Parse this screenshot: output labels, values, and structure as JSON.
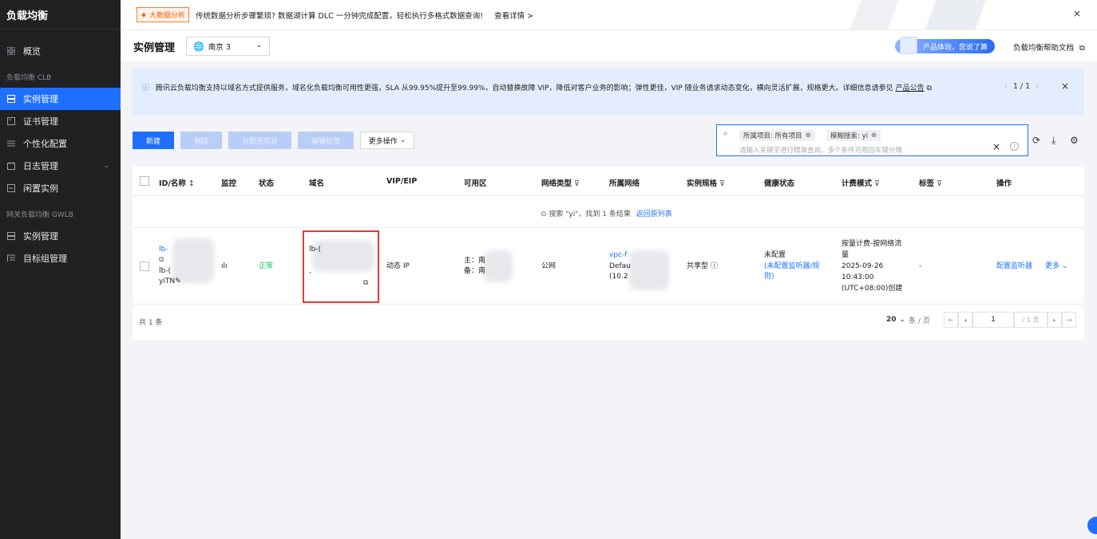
{
  "sidebar": {
    "brand": "负载均衡",
    "items": [
      {
        "label": "概览",
        "icon": "grid-icon"
      },
      {
        "label": "实例管理",
        "icon": "server-icon",
        "active": true
      },
      {
        "label": "证书管理",
        "icon": "certificate-icon"
      },
      {
        "label": "个性化配置",
        "icon": "sliders-icon"
      },
      {
        "label": "日志管理",
        "icon": "calendar-icon"
      },
      {
        "label": "闲置实例",
        "icon": "box-icon"
      },
      {
        "label": "实例管理",
        "icon": "server-icon"
      },
      {
        "label": "目标组管理",
        "icon": "list-icon"
      }
    ],
    "section_clb": "负载均衡 CLB",
    "section_gwlb": "网关负载均衡 GWLB"
  },
  "banner": {
    "badge": "♦ 大数据分析",
    "text": "传统数据分析步骤繁琐? 数据湖计算 DLC 一分钟完成配置，轻松执行多格式数据查询!",
    "link": "查看详情 >",
    "close": "×"
  },
  "header": {
    "title": "实例管理",
    "region": "南京 3",
    "promo": "产品体验，您说了算",
    "help": "负载均衡帮助文档"
  },
  "notice": {
    "text": "腾讯云负载均衡支持以域名方式提供服务，域名化负载均衡可用性更强，SLA 从99.95%提升至99.99%，自动替换故障 VIP，降低对客户业务的影响；弹性更佳，VIP 随业务请求动态变化，横向灵活扩展，规格更大。详细信息请参见",
    "link": "产品公告",
    "pager": "1 / 1"
  },
  "toolbar": {
    "new": "新建",
    "delete": "删除",
    "assign_project": "分配至项目",
    "edit_tags": "编辑标签",
    "more": "更多操作"
  },
  "search": {
    "tag1": "所属项目: 所有项目",
    "tag2": "模糊搜索: yi",
    "placeholder": "请输入关键字进行精准查询，多个条件可用回车键分隔"
  },
  "table": {
    "headers": [
      "ID/名称",
      "监控",
      "状态",
      "域名",
      "VIP/EIP",
      "可用区",
      "网络类型",
      "所属网络",
      "实例规格",
      "健康状态",
      "计费模式",
      "标签",
      "操作"
    ],
    "search_note": "搜索 \"yi\"，找到 1 条结果",
    "back_link": "返回原列表",
    "row": {
      "id": "lb-",
      "name": "lb-(",
      "alias": "yiTN",
      "status": "正常",
      "domain": "lb-(",
      "domain_tail": "-",
      "vip": "动态 IP",
      "zone_main": "主：南",
      "zone_backup": "备：南",
      "net_type": "公网",
      "vpc_id": "vpc-f",
      "vpc_name": "Defau",
      "vpc_cidr": "(10.2",
      "spec": "共享型",
      "health_1": "未配置",
      "health_2": "(未配置监听器/规",
      "health_3": "则)",
      "billing_1": "按量计费-按网络流",
      "billing_2": "量",
      "billing_3": "2025-09-26",
      "billing_4": "10:43:00",
      "billing_5": "(UTC+08:00)创建",
      "tag": "-",
      "action_config": "配置监听器",
      "action_more": "更多"
    },
    "total": "共 1 条",
    "page_size": "20",
    "page_size_unit": "条 / 页",
    "page": "1",
    "page_total": "/ 1 页"
  }
}
